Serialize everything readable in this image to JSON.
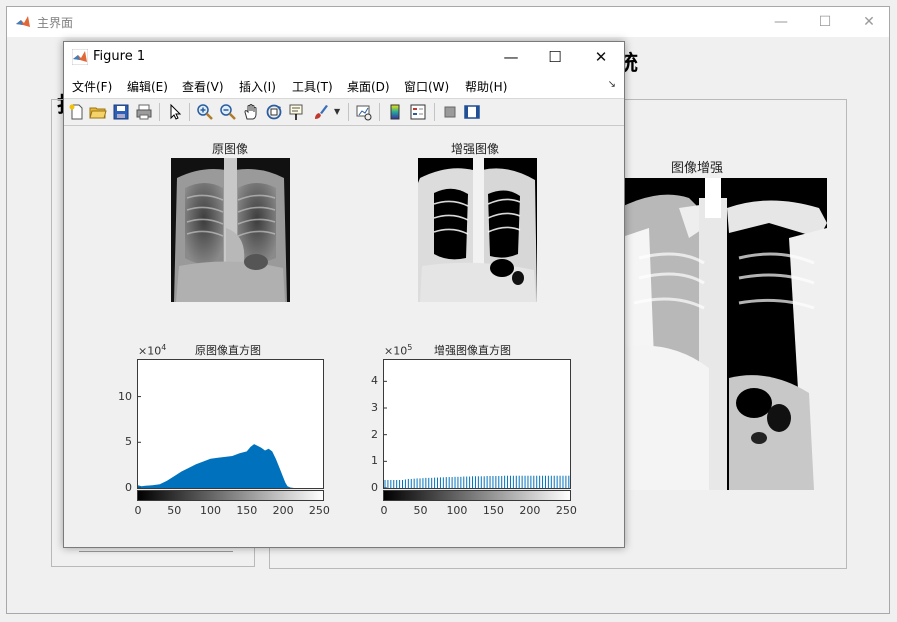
{
  "main_window": {
    "title": "主界面",
    "bg_title_left": "打",
    "bg_title_right": "统",
    "enhance_axis_title": "图像增强"
  },
  "figure": {
    "title": "Figure 1",
    "menu": [
      "文件(F)",
      "编辑(E)",
      "查看(V)",
      "插入(I)",
      "工具(T)",
      "桌面(D)",
      "窗口(W)",
      "帮助(H)"
    ],
    "toolbar_icons": [
      "new-figure-icon",
      "open-file-icon",
      "save-icon",
      "print-icon",
      "pointer-icon",
      "zoom-in-icon",
      "zoom-out-icon",
      "pan-hand-icon",
      "rotate-3d-icon",
      "data-cursor-icon",
      "brush-icon",
      "link-plot-icon",
      "colorbar-icon",
      "legend-icon",
      "hide-plot-tools-icon",
      "show-plot-tools-icon"
    ],
    "axes_titles": {
      "original_image": "原图像",
      "enhanced_image": "增强图像",
      "original_hist": "原图像直方图",
      "enhanced_hist": "增强图像直方图"
    }
  },
  "chart_data": [
    {
      "type": "area",
      "title": "原图像直方图",
      "x_ticks": [
        "0",
        "50",
        "100",
        "150",
        "200",
        "250"
      ],
      "y_ticks": [
        "0",
        "5",
        "10"
      ],
      "y_exponent": "×10",
      "y_exponent_power": "4",
      "xlim": [
        0,
        255
      ],
      "ylim": [
        0,
        14
      ],
      "x": [
        0,
        5,
        10,
        20,
        30,
        40,
        50,
        60,
        70,
        80,
        90,
        100,
        110,
        120,
        130,
        140,
        150,
        155,
        160,
        165,
        170,
        175,
        180,
        185,
        190,
        195,
        200,
        203,
        206,
        210,
        215,
        220,
        255
      ],
      "values": [
        0.3,
        0.2,
        0.25,
        0.3,
        0.4,
        0.8,
        1.3,
        1.8,
        2.2,
        2.6,
        2.9,
        3.2,
        3.3,
        3.4,
        3.5,
        3.8,
        4.0,
        4.5,
        4.8,
        4.6,
        4.4,
        4.1,
        4.3,
        4.0,
        3.2,
        2.2,
        1.2,
        0.6,
        0.2,
        0.05,
        0,
        0,
        0
      ],
      "color": "#0072BD"
    },
    {
      "type": "bar",
      "title": "增强图像直方图",
      "x_ticks": [
        "0",
        "50",
        "100",
        "150",
        "200",
        "250"
      ],
      "y_ticks": [
        "0",
        "1",
        "2",
        "3",
        "4"
      ],
      "y_exponent": "×10",
      "y_exponent_power": "5",
      "xlim": [
        0,
        255
      ],
      "ylim": [
        0,
        4.8
      ],
      "x": [
        0,
        4,
        8,
        12,
        16,
        20,
        24,
        28,
        32,
        36,
        40,
        44,
        48,
        52,
        56,
        60,
        64,
        68,
        72,
        76,
        80,
        84,
        88,
        92,
        96,
        100,
        104,
        108,
        112,
        116,
        120,
        124,
        128,
        132,
        136,
        140,
        144,
        148,
        152,
        156,
        160,
        164,
        168,
        172,
        176,
        180,
        184,
        188,
        192,
        196,
        200,
        204,
        208,
        212,
        216,
        220,
        224,
        228,
        232,
        236,
        240,
        244,
        248,
        252
      ],
      "values": [
        0.3,
        0.3,
        0.3,
        0.3,
        0.3,
        0.3,
        0.3,
        0.32,
        0.34,
        0.34,
        0.35,
        0.36,
        0.36,
        0.37,
        0.38,
        0.38,
        0.38,
        0.39,
        0.39,
        0.4,
        0.4,
        0.41,
        0.41,
        0.41,
        0.42,
        0.42,
        0.42,
        0.43,
        0.43,
        0.43,
        0.44,
        0.44,
        0.44,
        0.44,
        0.44,
        0.45,
        0.45,
        0.45,
        0.45,
        0.45,
        0.45,
        0.46,
        0.46,
        0.46,
        0.46,
        0.46,
        0.46,
        0.46,
        0.46,
        0.46,
        0.46,
        0.46,
        0.46,
        0.46,
        0.46,
        0.46,
        0.46,
        0.46,
        0.46,
        0.46,
        0.46,
        0.46,
        0.46,
        0.46
      ],
      "color": "#0072BD"
    }
  ]
}
